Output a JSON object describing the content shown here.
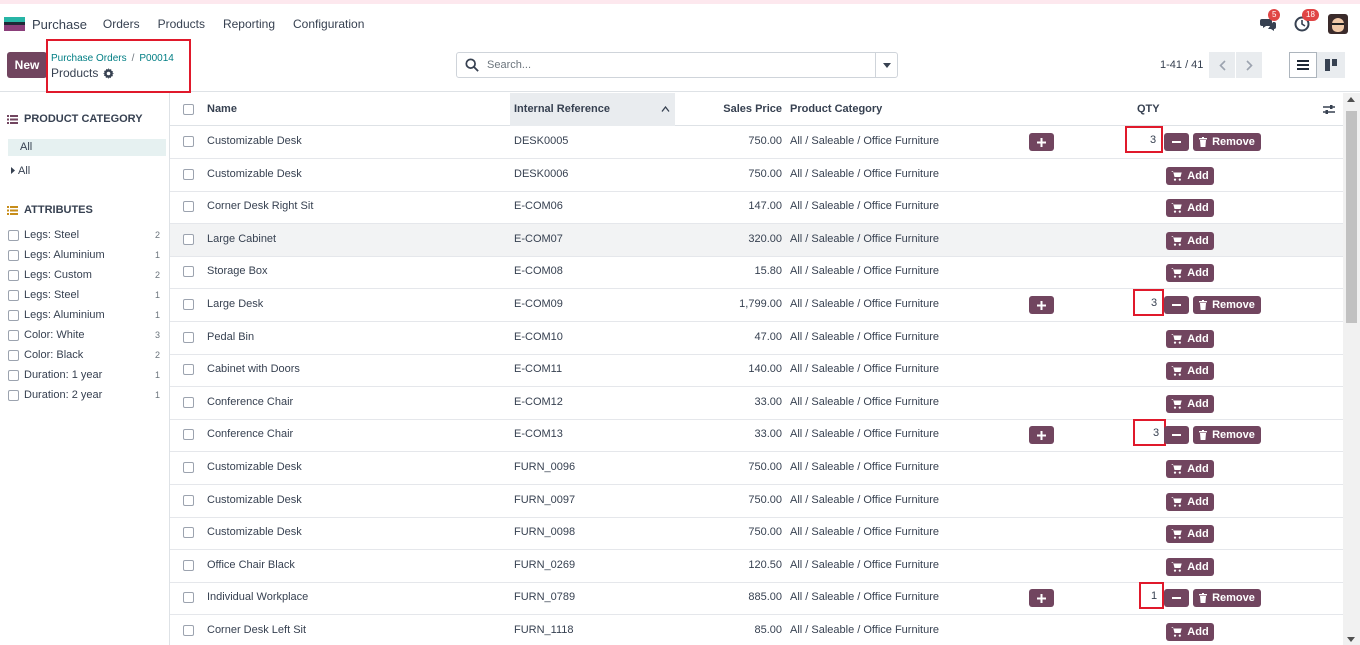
{
  "app": {
    "name": "Purchase"
  },
  "menu": [
    "Orders",
    "Products",
    "Reporting",
    "Configuration"
  ],
  "navbar": {
    "messages_count": "5",
    "activities_count": "18"
  },
  "control": {
    "new_label": "New",
    "breadcrumb": [
      "Purchase Orders",
      "P00014"
    ],
    "current": "Products",
    "search_placeholder": "Search...",
    "pager": "1-41 / 41"
  },
  "sidebar": {
    "category_title": "PRODUCT CATEGORY",
    "category_active": "All",
    "category_all": "All",
    "attributes_title": "ATTRIBUTES",
    "attributes": [
      {
        "label": "Legs: Steel",
        "count": "2"
      },
      {
        "label": "Legs: Aluminium",
        "count": "1"
      },
      {
        "label": "Legs: Custom",
        "count": "2"
      },
      {
        "label": "Legs: Steel",
        "count": "1"
      },
      {
        "label": "Legs: Aluminium",
        "count": "1"
      },
      {
        "label": "Color: White",
        "count": "3"
      },
      {
        "label": "Color: Black",
        "count": "2"
      },
      {
        "label": "Duration: 1 year",
        "count": "1"
      },
      {
        "label": "Duration: 2 year",
        "count": "1"
      }
    ]
  },
  "table": {
    "columns": {
      "name": "Name",
      "ref": "Internal Reference",
      "price": "Sales Price",
      "category": "Product Category",
      "qty": "QTY"
    },
    "add_label": "Add",
    "remove_label": "Remove",
    "rows": [
      {
        "name": "Customizable Desk",
        "ref": "DESK0005",
        "price": "750.00",
        "category": "All / Saleable / Office Furniture",
        "qty": "3"
      },
      {
        "name": "Customizable Desk",
        "ref": "DESK0006",
        "price": "750.00",
        "category": "All / Saleable / Office Furniture",
        "qty": ""
      },
      {
        "name": "Corner Desk Right Sit",
        "ref": "E-COM06",
        "price": "147.00",
        "category": "All / Saleable / Office Furniture",
        "qty": ""
      },
      {
        "name": "Large Cabinet",
        "ref": "E-COM07",
        "price": "320.00",
        "category": "All / Saleable / Office Furniture",
        "qty": ""
      },
      {
        "name": "Storage Box",
        "ref": "E-COM08",
        "price": "15.80",
        "category": "All / Saleable / Office Furniture",
        "qty": ""
      },
      {
        "name": "Large Desk",
        "ref": "E-COM09",
        "price": "1,799.00",
        "category": "All / Saleable / Office Furniture",
        "qty": "3"
      },
      {
        "name": "Pedal Bin",
        "ref": "E-COM10",
        "price": "47.00",
        "category": "All / Saleable / Office Furniture",
        "qty": ""
      },
      {
        "name": "Cabinet with Doors",
        "ref": "E-COM11",
        "price": "140.00",
        "category": "All / Saleable / Office Furniture",
        "qty": ""
      },
      {
        "name": "Conference Chair",
        "ref": "E-COM12",
        "price": "33.00",
        "category": "All / Saleable / Office Furniture",
        "qty": ""
      },
      {
        "name": "Conference Chair",
        "ref": "E-COM13",
        "price": "33.00",
        "category": "All / Saleable / Office Furniture",
        "qty": "3"
      },
      {
        "name": "Customizable Desk",
        "ref": "FURN_0096",
        "price": "750.00",
        "category": "All / Saleable / Office Furniture",
        "qty": ""
      },
      {
        "name": "Customizable Desk",
        "ref": "FURN_0097",
        "price": "750.00",
        "category": "All / Saleable / Office Furniture",
        "qty": ""
      },
      {
        "name": "Customizable Desk",
        "ref": "FURN_0098",
        "price": "750.00",
        "category": "All / Saleable / Office Furniture",
        "qty": ""
      },
      {
        "name": "Office Chair Black",
        "ref": "FURN_0269",
        "price": "120.50",
        "category": "All / Saleable / Office Furniture",
        "qty": ""
      },
      {
        "name": "Individual Workplace",
        "ref": "FURN_0789",
        "price": "885.00",
        "category": "All / Saleable / Office Furniture",
        "qty": "1"
      },
      {
        "name": "Corner Desk Left Sit",
        "ref": "FURN_1118",
        "price": "85.00",
        "category": "All / Saleable / Office Furniture",
        "qty": ""
      }
    ]
  },
  "colors": {
    "primary": "#71455f",
    "link": "#017e84",
    "highlight": "#e0192b"
  }
}
